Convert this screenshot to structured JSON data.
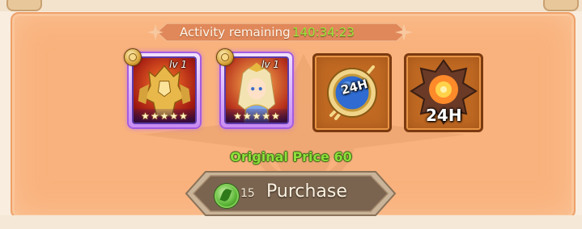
{
  "header": {
    "activity_label": "Activity remaining",
    "timer": "140:34:23"
  },
  "rewards": [
    {
      "type": "hero",
      "level": "lv 1",
      "stars": 5,
      "icon": "golden-armored-hero-portrait"
    },
    {
      "type": "hero",
      "level": "lv 1",
      "stars": 5,
      "icon": "blonde-heroine-portrait"
    },
    {
      "type": "item",
      "label": "24H",
      "icon": "compass-clock-icon"
    },
    {
      "type": "item",
      "label": "24H",
      "icon": "fiery-gem-icon"
    }
  ],
  "original_price": "Original Price 60",
  "purchase": {
    "price": "15",
    "label": "Purchase",
    "currency_icon": "green-leaf-coin-icon"
  },
  "colors": {
    "panel": "#f9b27d",
    "timer": "#9be63a",
    "original_price": "#8ee03a",
    "hero_frame": "#a45ce0",
    "item_frame": "#c06a23",
    "button": "#7a6450"
  }
}
